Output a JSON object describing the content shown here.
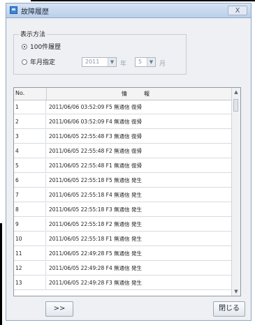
{
  "window": {
    "title": "故障履歴",
    "close_label": "X"
  },
  "filter": {
    "legend": "表示方法",
    "option1_label": "100件履歴",
    "option2_label": "年月指定",
    "year_value": "2011",
    "month_value": "5",
    "year_unit": "年",
    "month_unit": "月",
    "selected": "100件履歴"
  },
  "table": {
    "headers": {
      "no": "No.",
      "date": "情",
      "detail": "報"
    },
    "rows": [
      {
        "no": "1",
        "text": "2011/06/06 03:52:09  F5 無通信 復帰"
      },
      {
        "no": "2",
        "text": "2011/06/06 03:52:09  F4 無通信 復帰"
      },
      {
        "no": "3",
        "text": "2011/06/05 22:55:48  F3 無通信 復帰"
      },
      {
        "no": "4",
        "text": "2011/06/05 22:55:48  F2 無通信 復帰"
      },
      {
        "no": "5",
        "text": "2011/06/05 22:55:48  F1 無通信 復帰"
      },
      {
        "no": "6",
        "text": "2011/06/05 22:55:18  F5 無通信 発生"
      },
      {
        "no": "7",
        "text": "2011/06/05 22:55:18  F4 無通信 発生"
      },
      {
        "no": "8",
        "text": "2011/06/05 22:55:18  F3 無通信 発生"
      },
      {
        "no": "9",
        "text": "2011/06/05 22:55:18  F2 無通信 発生"
      },
      {
        "no": "10",
        "text": "2011/06/05 22:55:18  F1 無通信 発生"
      },
      {
        "no": "11",
        "text": "2011/06/05 22:49:28  F5 無通信 発生"
      },
      {
        "no": "12",
        "text": "2011/06/05 22:49:28  F4 無通信 発生"
      },
      {
        "no": "13",
        "text": "2011/06/05 22:49:28  F3 無通信 発生"
      }
    ]
  },
  "buttons": {
    "next_label": ">>",
    "close_label": "閉じる"
  },
  "icons": {
    "app": "app-window-icon",
    "close": "close-icon",
    "dropdown": "chevron-down-icon"
  }
}
